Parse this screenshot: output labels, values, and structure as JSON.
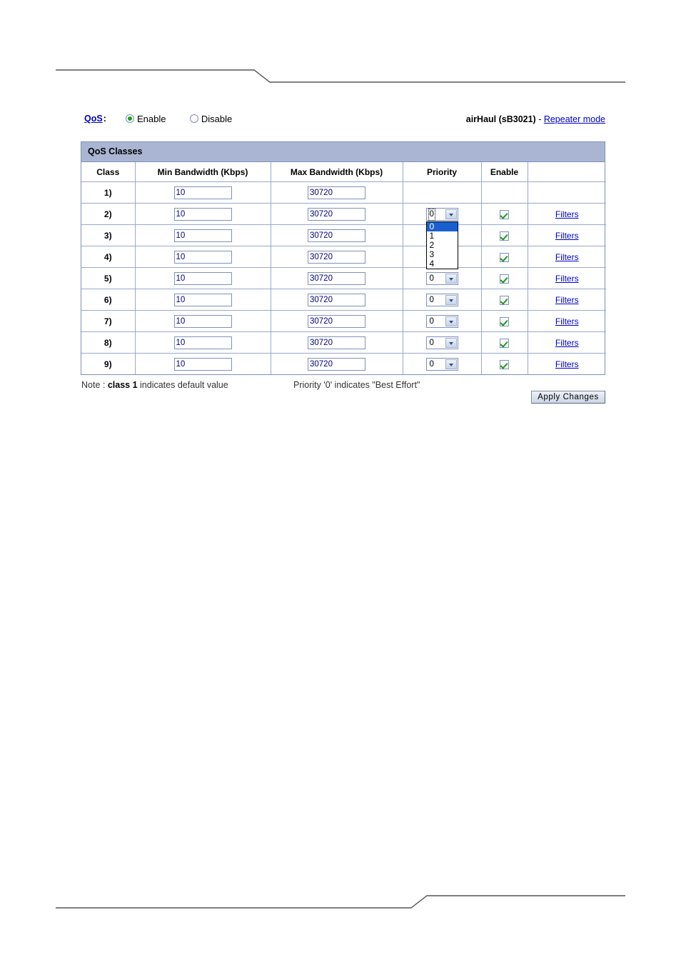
{
  "header": {
    "qos_label": "QoS",
    "qos_colon": ":",
    "radios": [
      {
        "label": "Enable",
        "checked": true
      },
      {
        "label": "Disable",
        "checked": false
      }
    ],
    "device_name": "airHaul (sB3021)",
    "separator": " - ",
    "mode_link": "Repeater mode"
  },
  "panel": {
    "title": "QoS Classes",
    "columns": [
      "Class",
      "Min Bandwidth (Kbps)",
      "Max Bandwidth (Kbps)",
      "Priority",
      "Enable",
      ""
    ],
    "priority_options": [
      "0",
      "1",
      "2",
      "3",
      "4"
    ],
    "filters_label": "Filters",
    "rows": [
      {
        "class": "1)",
        "min": "10",
        "max": "30720",
        "priority": "",
        "has_controls": false,
        "enabled": false,
        "dropdown_open": false
      },
      {
        "class": "2)",
        "min": "10",
        "max": "30720",
        "priority": "0",
        "has_controls": true,
        "enabled": true,
        "dropdown_open": true
      },
      {
        "class": "3)",
        "min": "10",
        "max": "30720",
        "priority": "0",
        "has_controls": true,
        "enabled": true,
        "dropdown_open": false
      },
      {
        "class": "4)",
        "min": "10",
        "max": "30720",
        "priority": "0",
        "has_controls": true,
        "enabled": true,
        "dropdown_open": false
      },
      {
        "class": "5)",
        "min": "10",
        "max": "30720",
        "priority": "0",
        "has_controls": true,
        "enabled": true,
        "dropdown_open": false
      },
      {
        "class": "6)",
        "min": "10",
        "max": "30720",
        "priority": "0",
        "has_controls": true,
        "enabled": true,
        "dropdown_open": false
      },
      {
        "class": "7)",
        "min": "10",
        "max": "30720",
        "priority": "0",
        "has_controls": true,
        "enabled": true,
        "dropdown_open": false
      },
      {
        "class": "8)",
        "min": "10",
        "max": "30720",
        "priority": "0",
        "has_controls": true,
        "enabled": true,
        "dropdown_open": false
      },
      {
        "class": "9)",
        "min": "10",
        "max": "30720",
        "priority": "0",
        "has_controls": true,
        "enabled": true,
        "dropdown_open": false
      }
    ]
  },
  "footer": {
    "note_prefix": "Note : ",
    "note_bold": "class 1",
    "note_suffix": " indicates default value",
    "note_right": "Priority '0' indicates \"Best Effort\"",
    "apply_label": "Apply Changes"
  },
  "colors": {
    "panel_header": "#a9b5d3",
    "border": "#8090b8",
    "link": "#0000cc",
    "input_text": "#000080",
    "check_green": "#1a9b1a",
    "highlight": "#1a5fd0"
  }
}
